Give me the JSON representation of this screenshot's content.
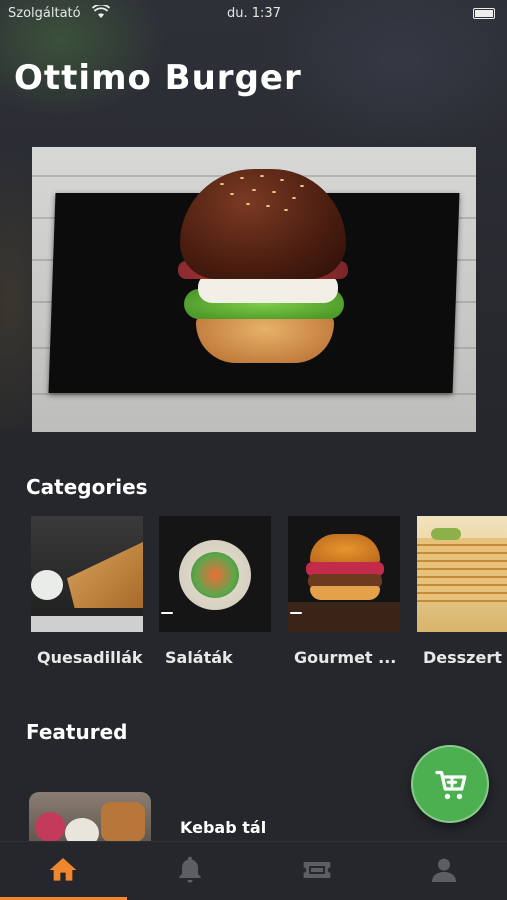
{
  "status_bar": {
    "carrier": "Szolgáltató",
    "time": "du. 1:37"
  },
  "app": {
    "title": "Ottimo Burger"
  },
  "sections": {
    "categories_title": "Categories",
    "featured_title": "Featured"
  },
  "categories": [
    {
      "label": "Quesadillák"
    },
    {
      "label": "Saláták"
    },
    {
      "label": "Gourmet ..."
    },
    {
      "label": "Desszert"
    }
  ],
  "featured": [
    {
      "name": "Kebab tál"
    }
  ],
  "tabs": [
    {
      "icon": "home-icon",
      "active": true
    },
    {
      "icon": "bell-icon",
      "active": false
    },
    {
      "icon": "ticket-icon",
      "active": false
    },
    {
      "icon": "profile-icon",
      "active": false
    }
  ],
  "colors": {
    "background": "#26272c",
    "accent": "#f0872e",
    "cart_button": "#4caf50",
    "inactive_icon": "#5d5e63"
  }
}
